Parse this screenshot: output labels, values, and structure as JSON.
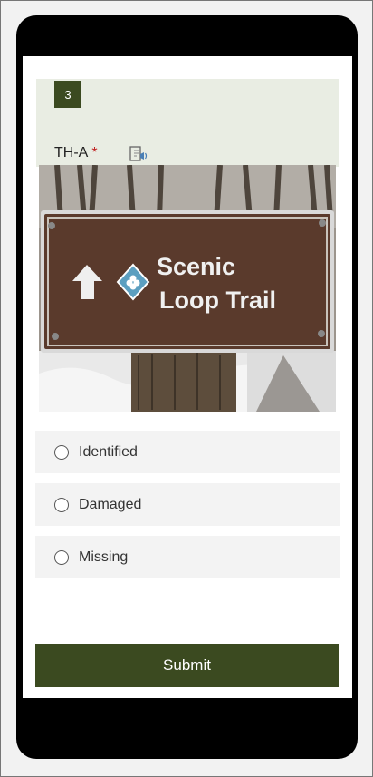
{
  "question": {
    "number": "3",
    "title": "TH-A",
    "required_marker": "*",
    "icon": "immersive-reader-icon"
  },
  "image": {
    "sign_line1": "Scenic",
    "sign_line2": "Loop Trail"
  },
  "options": [
    {
      "label": "Identified",
      "selected": false
    },
    {
      "label": "Damaged",
      "selected": false
    },
    {
      "label": "Missing",
      "selected": false
    }
  ],
  "submit_label": "Submit",
  "colors": {
    "accent": "#3b4a20",
    "card_background": "#e9ede3",
    "option_background": "#f3f3f3",
    "required": "#c02020"
  }
}
